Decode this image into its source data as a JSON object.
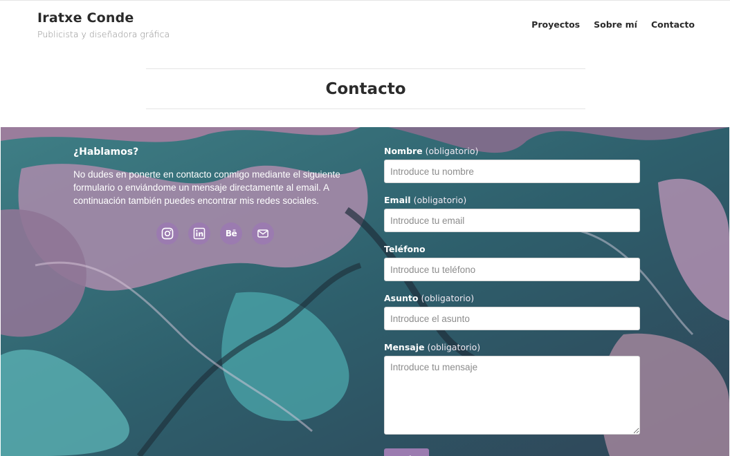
{
  "header": {
    "site_title": "Iratxe Conde",
    "tagline": "Publicista y diseñadora gráfica",
    "nav": [
      {
        "label": "Proyectos"
      },
      {
        "label": "Sobre mí"
      },
      {
        "label": "Contacto"
      }
    ]
  },
  "page": {
    "title": "Contacto"
  },
  "contact": {
    "heading": "¿Hablamos?",
    "text": "No dudes en ponerte en contacto conmigo mediante el siguiente formulario o enviándome un mensaje directamente al email. A continuación también puedes encontrar mis redes sociales.",
    "socials": [
      {
        "icon": "instagram-icon"
      },
      {
        "icon": "linkedin-icon"
      },
      {
        "icon": "behance-icon",
        "glyph": "Bē"
      },
      {
        "icon": "email-icon"
      }
    ],
    "accent_color": "#9b7bb0"
  },
  "form": {
    "required_suffix": "(obligatorio)",
    "name": {
      "label": "Nombre",
      "placeholder": "Introduce tu nombre"
    },
    "email": {
      "label": "Email",
      "placeholder": "Introduce tu email"
    },
    "phone": {
      "label": "Teléfono",
      "placeholder": "Introduce tu teléfono"
    },
    "subject": {
      "label": "Asunto",
      "placeholder": "Introduce el asunto"
    },
    "message": {
      "label": "Mensaje",
      "placeholder": "Introduce tu mensaje"
    },
    "submit_label": "Enviar"
  }
}
